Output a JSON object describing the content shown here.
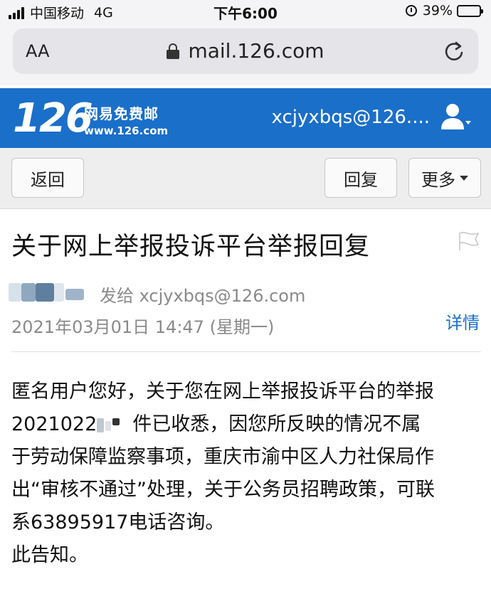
{
  "status_bar": {
    "carrier": "中国移动",
    "network": "4G",
    "time": "下午6:00",
    "battery": "39%"
  },
  "browser": {
    "aa_label": "AA",
    "url": "mail.126.com",
    "icons": [
      "lock-icon",
      "reload-icon"
    ]
  },
  "header": {
    "logo_number": "126",
    "logo_cn": "网易免费邮",
    "logo_en": "www.126.com",
    "account": "xcjyxbqs@126....",
    "colors": {
      "brand": "#1a6fc9"
    }
  },
  "toolbar": {
    "back_label": "返回",
    "reply_label": "回复",
    "more_label": "更多"
  },
  "message": {
    "subject": "关于网上举报投诉平台举报回复",
    "sent_to": "发给 xcjyxbqs@126.com",
    "date": "2021年03月01日 14:47 (星期一)",
    "detail_label": "详情",
    "body": {
      "line1": "匿名用户您好，关于您在网上举报投诉平台的举报",
      "line2_prefix": "2021022",
      "line2_suffix": "件已收悉，因您所反映的情况不属",
      "line3": "于劳动保障监察事项，重庆市渝中区人力社保局作",
      "line4": "出“审核不通过”处理，关于公务员招聘政策，可联",
      "line5": "系63895917电话咨询。",
      "line6": "此告知。"
    }
  }
}
